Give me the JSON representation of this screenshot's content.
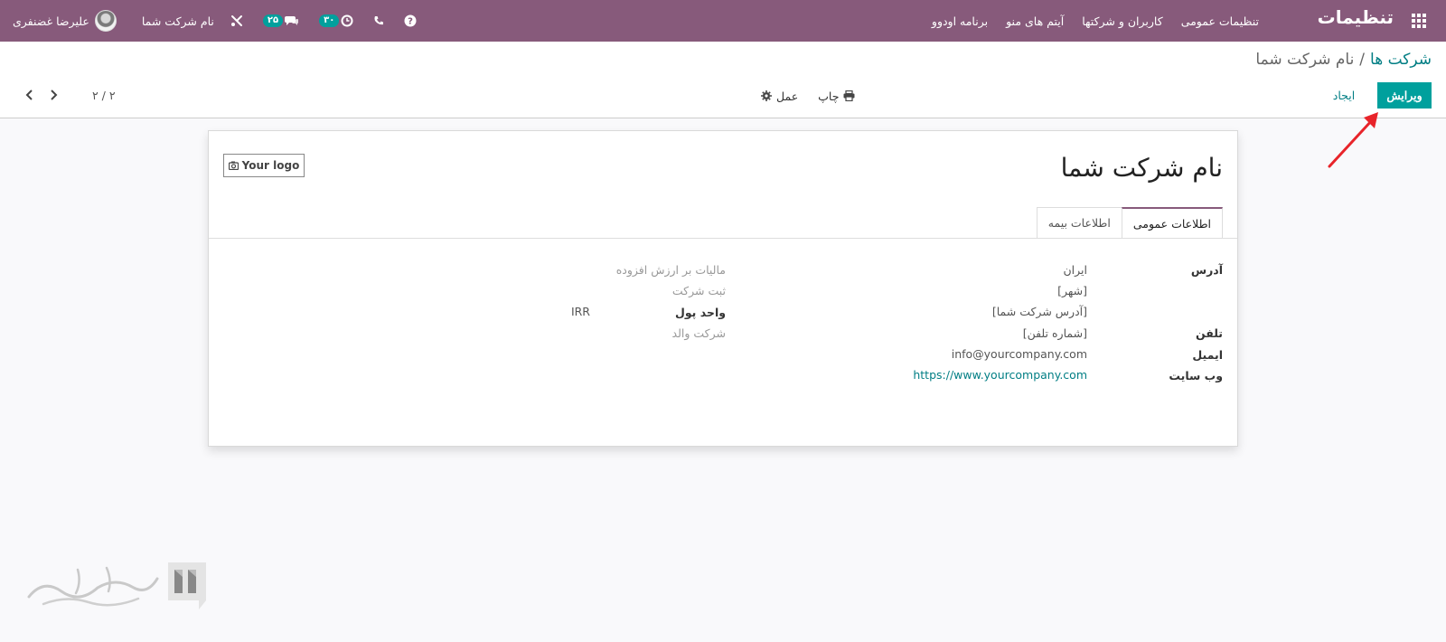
{
  "navbar": {
    "brand": "تنظیمات",
    "menu": [
      "تنظیمات عمومی",
      "کاربران و شرکتها",
      "آیتم های منو",
      "برنامه اودوو"
    ],
    "user_name": "علیرضا غضنفری",
    "company_name": "نام شرکت شما",
    "activity_count": "۳۰",
    "message_count": "۲۵"
  },
  "breadcrumb": {
    "parent": "شرکت ها",
    "separator": "/",
    "current": "نام شرکت شما"
  },
  "toolbar": {
    "edit_label": "ویرایش",
    "create_label": "ایجاد",
    "print_label": "چاپ",
    "action_label": "عمل"
  },
  "pager": {
    "counter": "۲ / ۲"
  },
  "form": {
    "logo_label": "Your logo",
    "title": "نام شرکت شما",
    "tabs": {
      "general": "اطلاعات عمومی",
      "insurance": "اطلاعات بیمه"
    },
    "right_fields": {
      "address_label": "آدرس",
      "country": "ایران",
      "city_placeholder": "[شهر]",
      "street_placeholder": "[آدرس شرکت شما]",
      "phone_label": "تلفن",
      "phone_placeholder": "[شماره تلفن]",
      "email_label": "ایمیل",
      "email": "info@yourcompany.com",
      "website_label": "وب سایت",
      "website": "https://www.yourcompany.com"
    },
    "left_fields": {
      "vat_label": "مالیات بر ارزش افزوده",
      "registry_label": "ثبت شرکت",
      "currency_label": "واحد پول",
      "currency": "IRR",
      "parent_company_label": "شرکت والد"
    }
  },
  "colors": {
    "navbar": "#875a7b",
    "primary": "#00a09d",
    "link": "#017e84",
    "annotation": "#e8242a"
  }
}
